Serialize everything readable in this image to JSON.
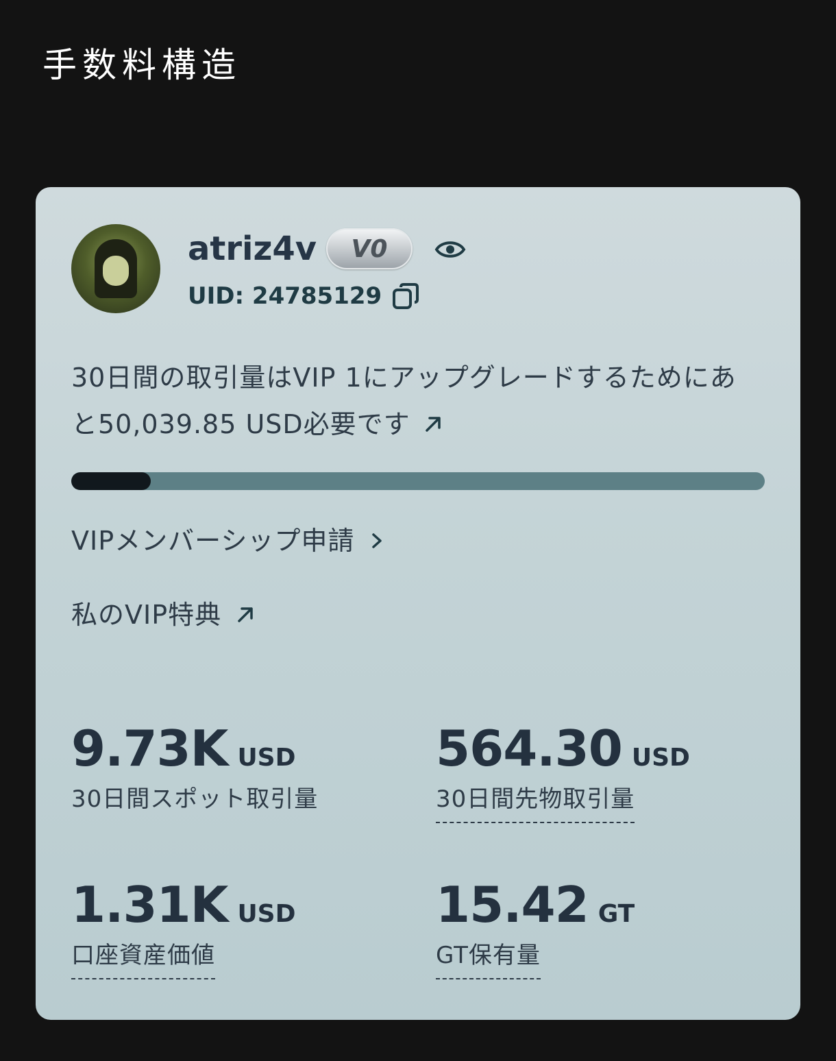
{
  "page": {
    "title": "手数料構造"
  },
  "profile": {
    "username": "atriz4v",
    "vip_badge": "V0",
    "uid_text": "UID: 24785129"
  },
  "upgrade": {
    "message": "30日間の取引量はVIP 1にアップグレードするためにあと50,039.85 USD必要です",
    "progress_fraction": 0.115
  },
  "links": {
    "vip_apply": "VIPメンバーシップ申請",
    "vip_benefits": "私のVIP特典"
  },
  "stats": [
    {
      "value": "9.73K",
      "unit": "USD",
      "label": "30日間スポット取引量"
    },
    {
      "value": "564.30",
      "unit": "USD",
      "label": "30日間先物取引量"
    },
    {
      "value": "1.31K",
      "unit": "USD",
      "label": "口座資産価値"
    },
    {
      "value": "15.42",
      "unit": "GT",
      "label": "GT保有量"
    }
  ],
  "colors": {
    "background": "#131313",
    "card_top": "#cfdadd",
    "text_primary": "#24313f",
    "progress_track": "#5d8086",
    "progress_fill": "#11181d"
  },
  "icons": {
    "eye": "eye-icon",
    "copy": "copy-icon",
    "external_arrow": "arrow-up-right-icon",
    "chevron": "chevron-right-icon"
  }
}
